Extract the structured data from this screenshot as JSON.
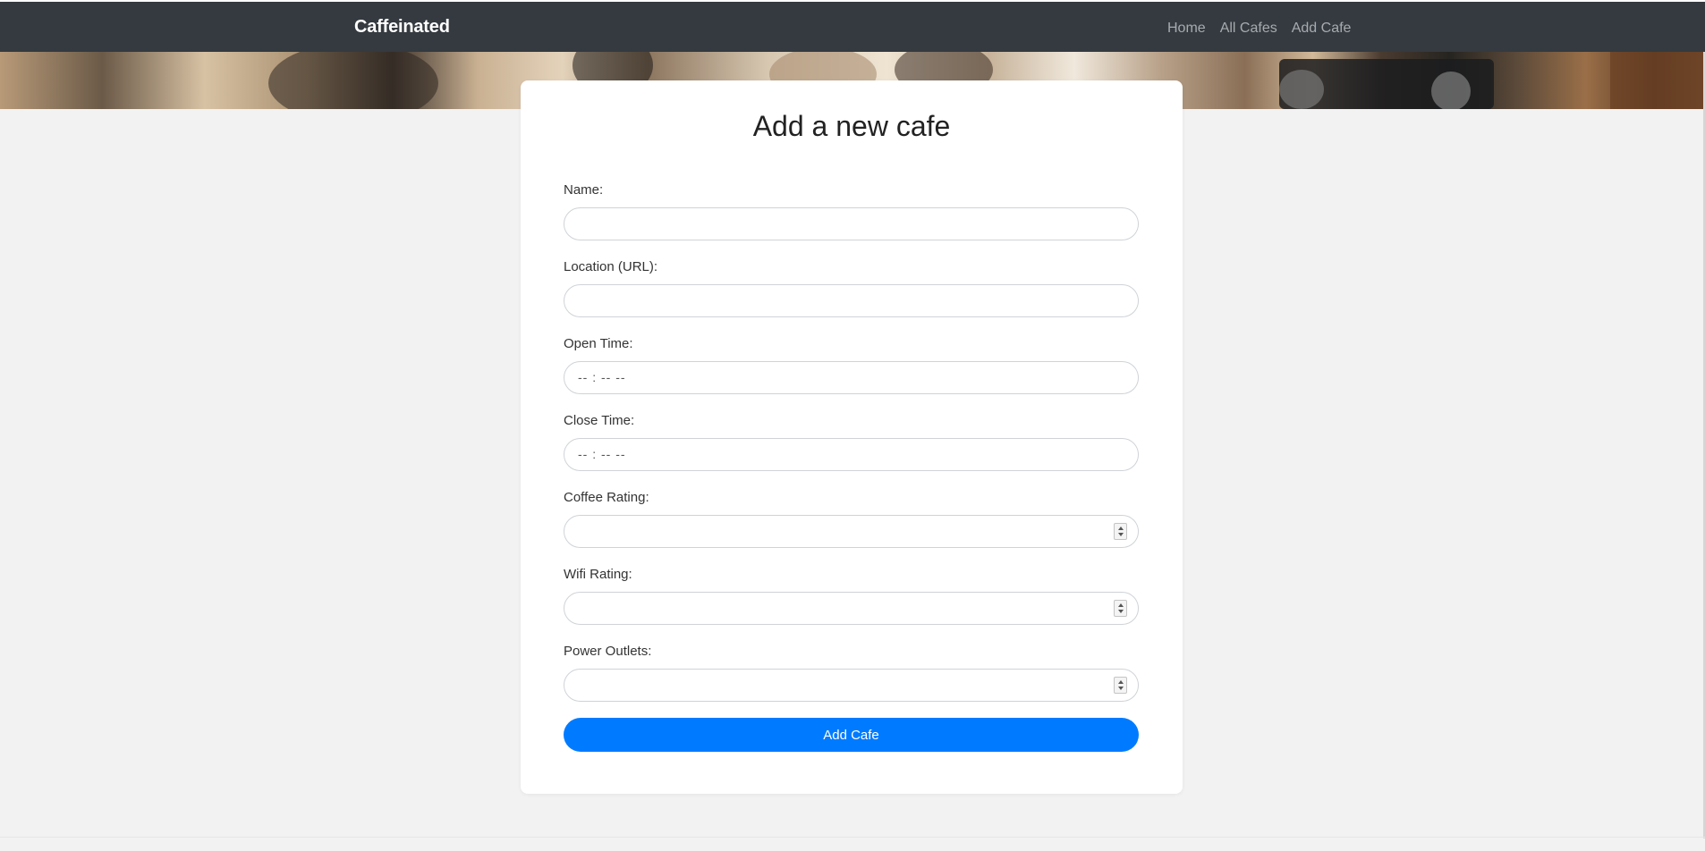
{
  "navbar": {
    "brand": "Caffeinated",
    "links": [
      "Home",
      "All Cafes",
      "Add Cafe"
    ]
  },
  "form": {
    "title": "Add a new cafe",
    "fields": [
      {
        "label": "Name:",
        "type": "text",
        "value": ""
      },
      {
        "label": "Location (URL):",
        "type": "url",
        "value": ""
      },
      {
        "label": "Open Time:",
        "type": "time",
        "placeholder": "-- : --  --"
      },
      {
        "label": "Close Time:",
        "type": "time",
        "placeholder": "-- : --  --"
      },
      {
        "label": "Coffee Rating:",
        "type": "number",
        "value": ""
      },
      {
        "label": "Wifi Rating:",
        "type": "number",
        "value": ""
      },
      {
        "label": "Power Outlets:",
        "type": "number",
        "value": ""
      }
    ],
    "submit_label": "Add Cafe"
  },
  "colors": {
    "navbar_bg": "#343a40",
    "page_bg": "#f2f2f2",
    "accent": "#007bff"
  }
}
